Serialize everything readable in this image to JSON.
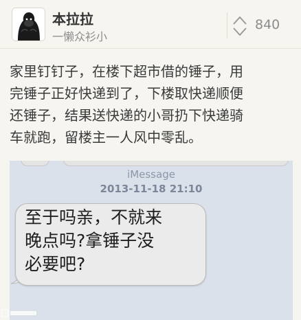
{
  "post": {
    "author": "本拉拉",
    "author_subtitle": "一懒众衫小",
    "vote_count": "840",
    "text_lines": [
      "家里钉钉子，在楼下超市借的锤子，用",
      "完锤子正好快递到了，下楼取快递顺便",
      "还锤子，结果送快递的小哥扔下快递骑",
      "车就跑，留楼主一人风中零乱。"
    ]
  },
  "screenshot": {
    "service_label": "iMessage",
    "timestamp": "2013-11-18 21:10",
    "message_lines": [
      "至于吗亲，不就来",
      "晚点吗?拿锤子没",
      "必要吧?"
    ]
  },
  "icons": {
    "avatar": "gorilla-avatar-icon",
    "vote": "up-down-vote-icon"
  },
  "colors": {
    "background": "#f6f5f0",
    "imessage_bg": "#dbe1ea",
    "bubble": "#ebebeb"
  }
}
